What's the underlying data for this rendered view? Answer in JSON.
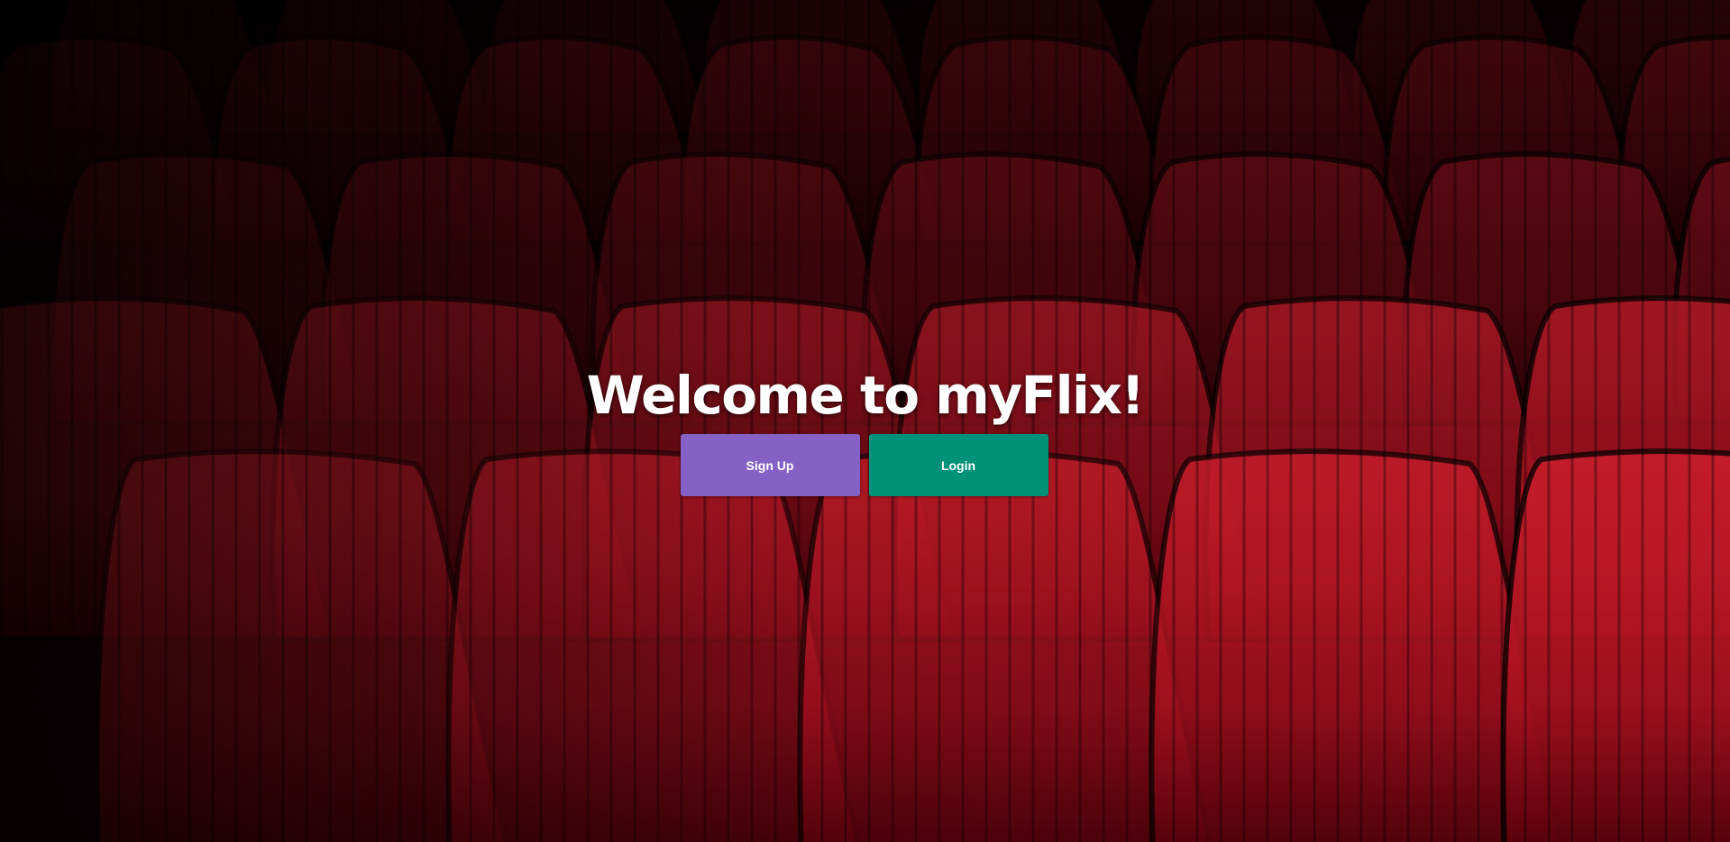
{
  "page": {
    "title": "Welcome to myFlix!"
  },
  "background": {
    "description_icon": "theater-seats",
    "colors": {
      "seat_dark": "#3d0008",
      "seat_mid": "#8a0e1c",
      "seat_light": "#c8192b",
      "backdrop": "#000000"
    }
  },
  "buttons": {
    "signup": {
      "label": "Sign Up",
      "color": "#8561c5"
    },
    "login": {
      "label": "Login",
      "color": "#00917a"
    }
  }
}
